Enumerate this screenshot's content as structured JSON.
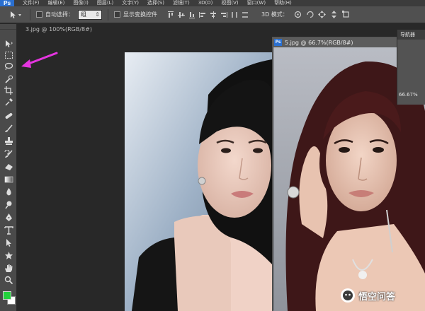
{
  "app": {
    "logo": "Ps"
  },
  "menu": [
    "文件(F)",
    "编辑(E)",
    "图像(I)",
    "图层(L)",
    "文字(Y)",
    "选择(S)",
    "滤镜(T)",
    "3D(D)",
    "视图(V)",
    "窗口(W)",
    "帮助(H)"
  ],
  "options_bar": {
    "auto_select_label": "自动选择：",
    "auto_select_value": "组",
    "show_transform_label": "显示变换控件",
    "mode_3d_label": "3D 模式："
  },
  "documents": [
    {
      "tab_title": "3.jpg @ 100%(RGB/8#)"
    },
    {
      "tab_title": "5.jpg @ 66.7%(RGB/8#)"
    }
  ],
  "navigator": {
    "tab_label": "导航器",
    "zoom": "66.67%"
  },
  "watermark": {
    "text": "悟空问答"
  },
  "colors": {
    "foreground": "#22d03c",
    "background": "#ffffff",
    "annotation_arrow": "#e535e0"
  },
  "icons": [
    "move-tool-icon",
    "marquee-icon",
    "lasso-icon",
    "quick-selection-icon",
    "crop-icon",
    "eyedropper-icon",
    "healing-brush-icon",
    "brush-icon",
    "clone-stamp-icon",
    "history-brush-icon",
    "eraser-icon",
    "gradient-icon",
    "blur-icon",
    "dodge-icon",
    "pen-icon",
    "type-icon",
    "path-selection-icon",
    "shape-icon",
    "hand-icon",
    "zoom-icon"
  ]
}
